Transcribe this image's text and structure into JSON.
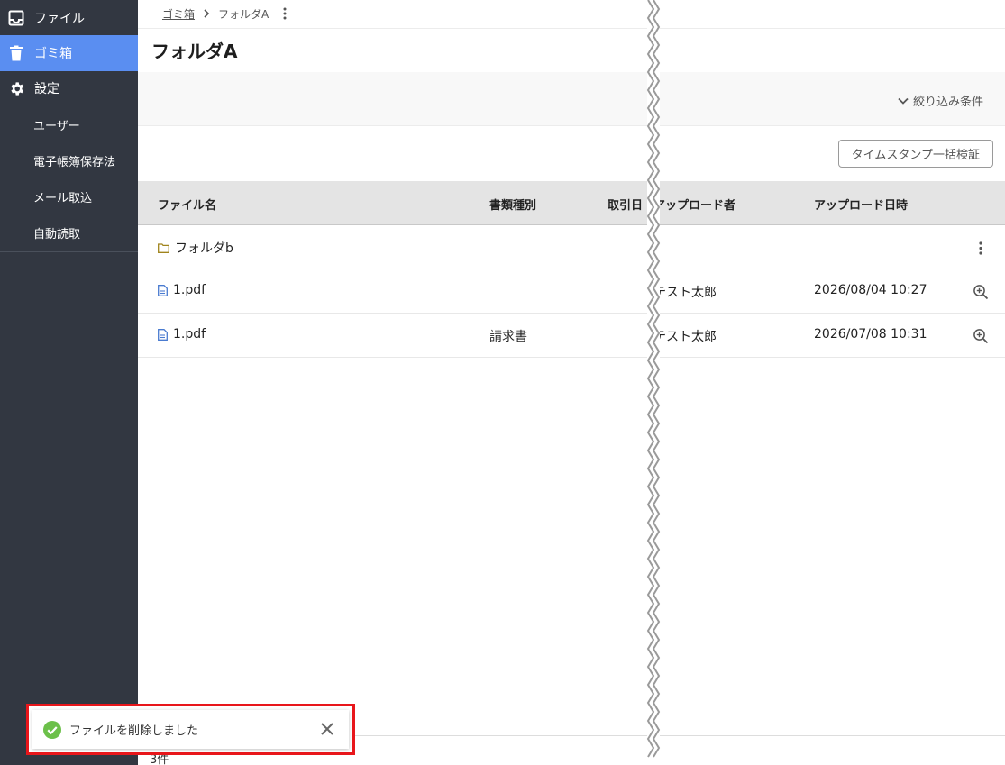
{
  "sidebar": {
    "items": [
      {
        "label": "ファイル",
        "icon": "inbox-icon"
      },
      {
        "label": "ゴミ箱",
        "icon": "trash-icon",
        "active": true
      },
      {
        "label": "設定",
        "icon": "gear-icon"
      }
    ],
    "sub_items": [
      {
        "label": "ユーザー"
      },
      {
        "label": "電子帳簿保存法"
      },
      {
        "label": "メール取込"
      },
      {
        "label": "自動読取"
      }
    ]
  },
  "breadcrumb": {
    "parent": "ゴミ箱",
    "current": "フォルダA"
  },
  "page": {
    "title": "フォルダA"
  },
  "filter": {
    "label": "絞り込み条件"
  },
  "toolbar": {
    "verify_label": "タイムスタンプ一括検証"
  },
  "table": {
    "columns": [
      "ファイル名",
      "書類種別",
      "取引日",
      "アップロード者",
      "アップロード日時"
    ],
    "rows": [
      {
        "type": "folder",
        "name": "フォルダb",
        "doc_type": "",
        "trade_date": "",
        "uploader": "",
        "uploaded_at": "",
        "action": "more-vertical-icon"
      },
      {
        "type": "file",
        "name": "1.pdf",
        "doc_type": "",
        "trade_date": "",
        "uploader": "テスト太郎",
        "uploaded_at": "2026/08/04 10:27",
        "action": "zoom-in-icon"
      },
      {
        "type": "file",
        "name": "1.pdf",
        "doc_type": "請求書",
        "trade_date": "",
        "uploader": "テスト太郎",
        "uploaded_at": "2026/07/08 10:31",
        "action": "zoom-in-icon"
      }
    ]
  },
  "footer": {
    "count": "3件"
  },
  "toast": {
    "message": "ファイルを削除しました"
  },
  "colors": {
    "sidebar_bg": "#323741",
    "active_bg": "#5a8ef1",
    "success_green": "#6cc04a",
    "highlight_red": "#e8161b",
    "folder_color": "#a0841c",
    "file_color": "#4a7bd0"
  }
}
